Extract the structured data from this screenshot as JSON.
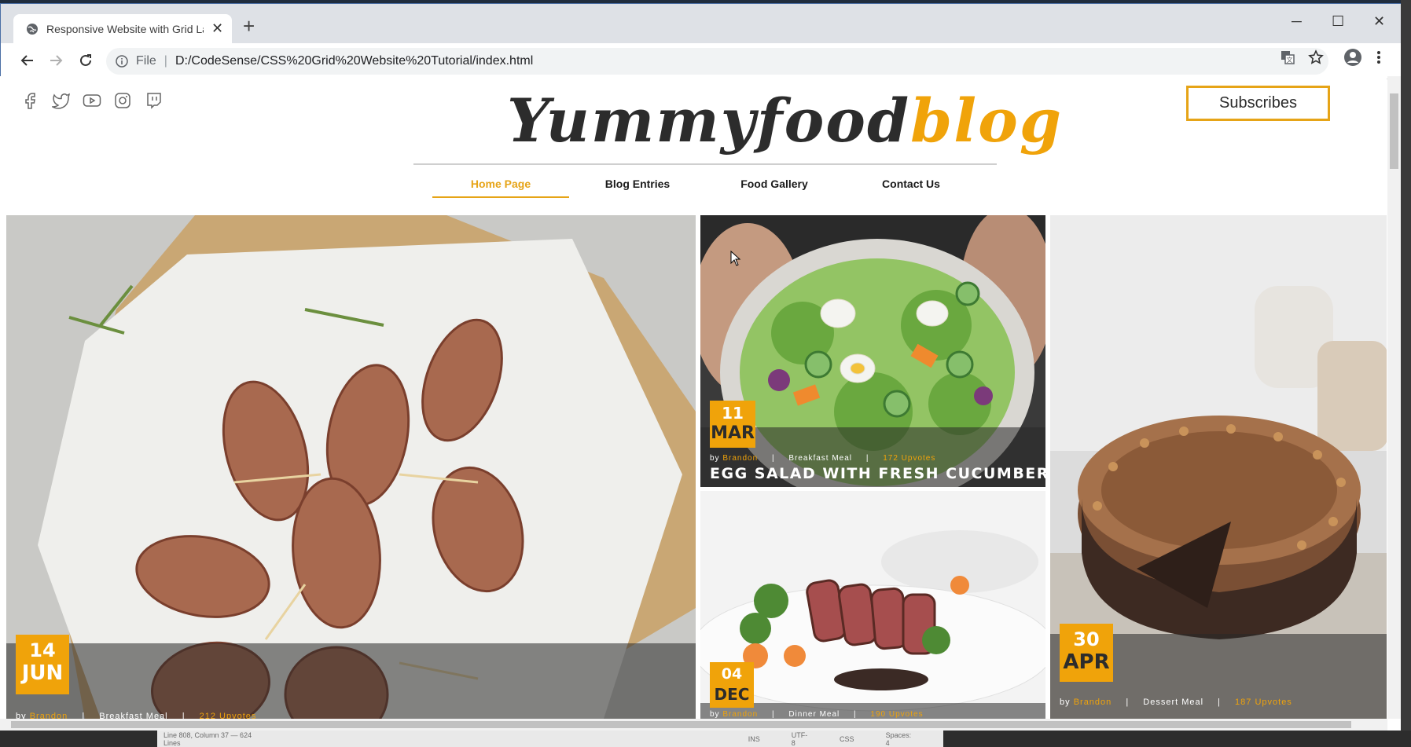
{
  "browser": {
    "tab_title": "Responsive Website with Grid La",
    "address_scheme": "File",
    "address_url": "D:/CodeSense/CSS%20Grid%20Website%20Tutorial/index.html"
  },
  "header": {
    "logo_dark": "Yummyfood",
    "logo_accent": "blog",
    "subscribe_label": "Subscribes",
    "social_icons": [
      "facebook-icon",
      "twitter-icon",
      "youtube-icon",
      "instagram-icon",
      "twitch-icon"
    ]
  },
  "menu": {
    "items": [
      {
        "label": "Home Page",
        "active": true
      },
      {
        "label": "Blog Entries",
        "active": false
      },
      {
        "label": "Food Gallery",
        "active": false
      },
      {
        "label": "Contact Us",
        "active": false
      }
    ]
  },
  "posts": [
    {
      "day": "14",
      "month": "JUN",
      "author_prefix": "by",
      "author": "Brandon",
      "category": "Breakfast Meal",
      "upvotes": "212 Upvotes",
      "title": ""
    },
    {
      "day": "11",
      "month": "MAR",
      "author_prefix": "by",
      "author": "Brandon",
      "category": "Breakfast Meal",
      "upvotes": "172 Upvotes",
      "title": "EGG SALAD WITH FRESH CUCUMBER"
    },
    {
      "day": "04",
      "month": "DEC",
      "author_prefix": "by",
      "author": "Brandon",
      "category": "Dinner Meal",
      "upvotes": "190 Upvotes",
      "title": ""
    },
    {
      "day": "30",
      "month": "APR",
      "author_prefix": "by",
      "author": "Brandon",
      "category": "Dessert Meal",
      "upvotes": "187 Upvotes",
      "title": ""
    }
  ],
  "status_bar": {
    "position": "Line 808, Column 37 — 624 Lines",
    "mode": "INS",
    "encoding": "UTF-8",
    "language": "CSS",
    "indent": "Spaces: 4"
  },
  "colors": {
    "accent": "#f0a30a",
    "subscribe_border": "#e6a417",
    "logo_dark": "#2c2c2c"
  }
}
